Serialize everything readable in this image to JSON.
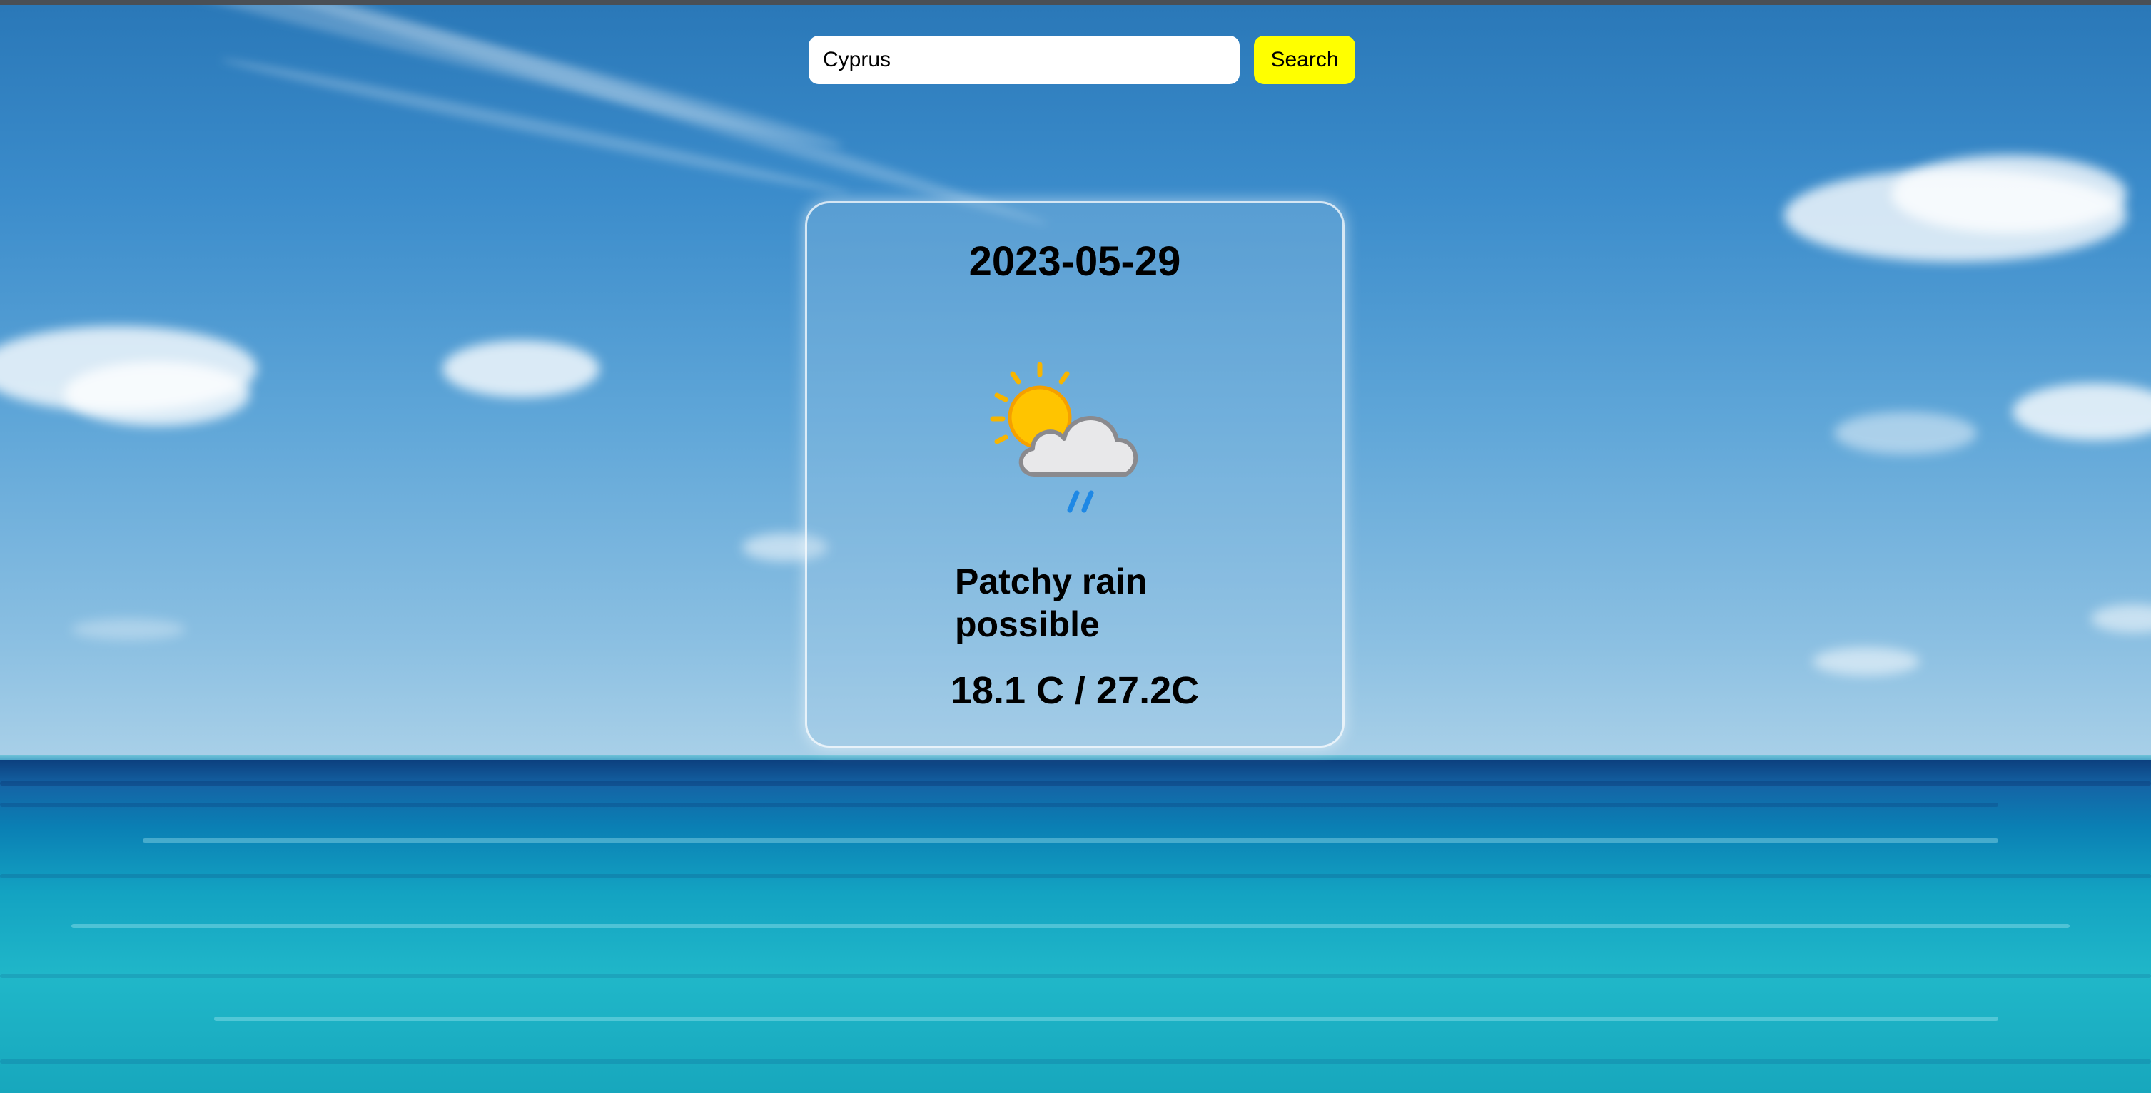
{
  "search": {
    "value": "Cyprus",
    "button_label": "Search"
  },
  "forecast": {
    "date": "2023-05-29",
    "icon": "partly-cloudy-rain-icon",
    "condition": "Patchy rain possible",
    "temperature": "18.1 C / 27.2C"
  },
  "colors": {
    "search_button": "#ffff00",
    "search_input": "#ffffff",
    "text": "#000000"
  }
}
